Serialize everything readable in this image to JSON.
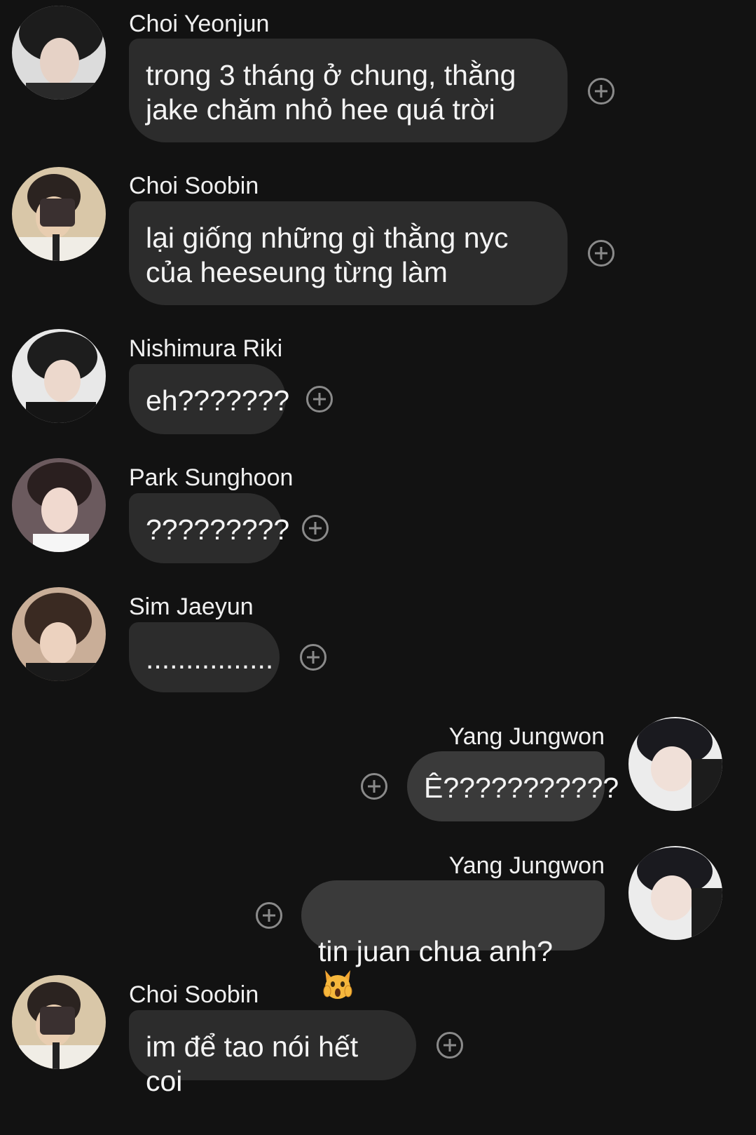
{
  "messages": [
    {
      "sender": "Choi Yeonjun",
      "text": "trong 3 tháng ở chung, thằng\njake chăm nhỏ hee quá trời",
      "side": "in",
      "avatar": "avatar-yeonjun"
    },
    {
      "sender": "Choi Soobin",
      "text": "lại giống những gì thằng nyc\ncủa heeseung từng làm",
      "side": "in",
      "avatar": "avatar-soobin"
    },
    {
      "sender": "Nishimura Riki",
      "text": "eh???????",
      "side": "in",
      "avatar": "avatar-riki"
    },
    {
      "sender": "Park Sunghoon",
      "text": "?????????",
      "side": "in",
      "avatar": "avatar-sunghoon"
    },
    {
      "sender": "Sim Jaeyun",
      "text": "................",
      "side": "in",
      "avatar": "avatar-jaeyun"
    },
    {
      "sender": "Yang Jungwon",
      "text": "Ê???????????",
      "side": "out",
      "avatar": "avatar-jungwon"
    },
    {
      "sender": "Yang Jungwon",
      "text": "tin juan chua anh?",
      "emoji": "screaming-cat-emoji",
      "side": "out",
      "avatar": "avatar-jungwon"
    },
    {
      "sender": "Choi Soobin",
      "text": "im để tao nói hết coi",
      "side": "in",
      "avatar": "avatar-soobin"
    }
  ],
  "icons": {
    "reaction": "add-reaction-icon"
  },
  "colors": {
    "background": "#121212",
    "bubble_incoming": "#2c2c2c",
    "bubble_outgoing": "#3a3a3a",
    "icon": "#8a8a8a"
  }
}
